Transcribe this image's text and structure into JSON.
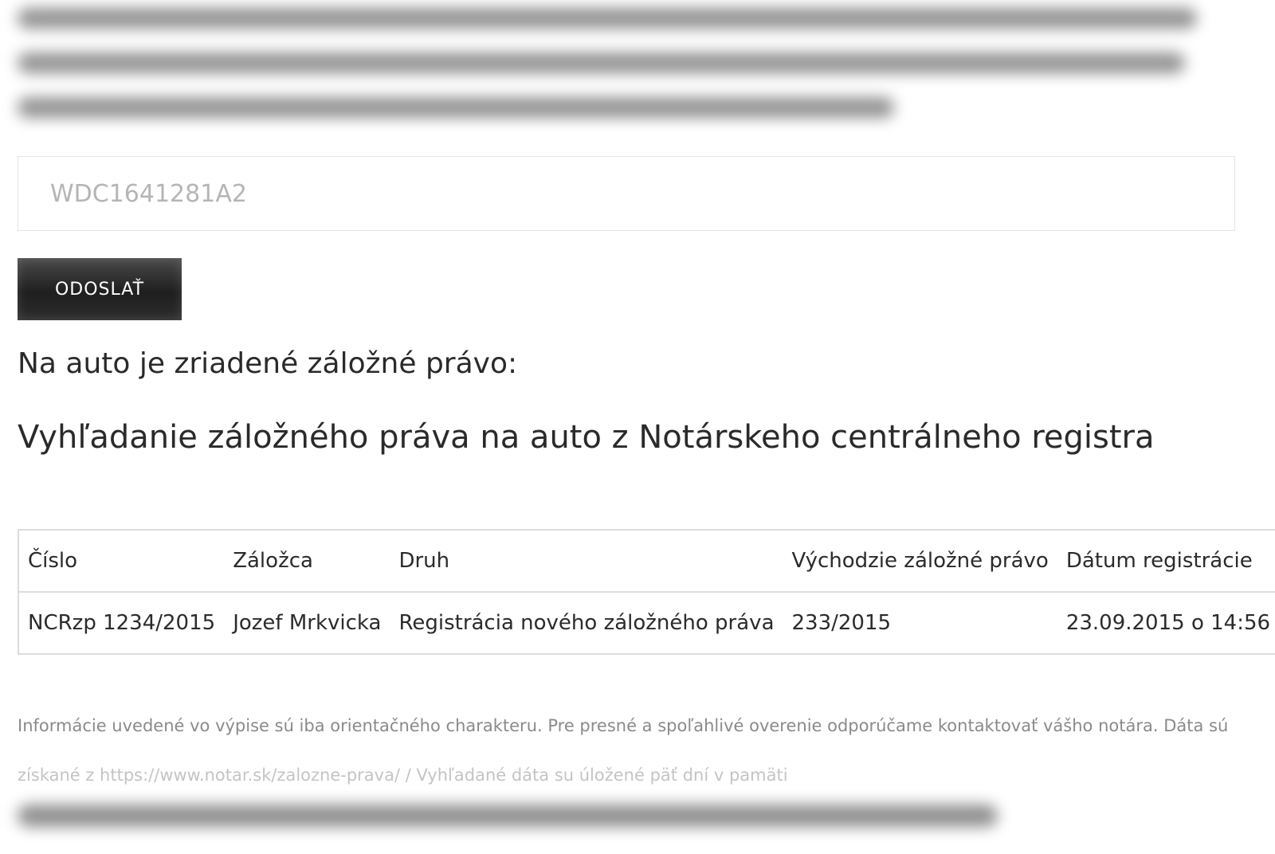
{
  "form": {
    "vin_placeholder": "WDC1641281A2",
    "submit_label": "ODOSLAŤ"
  },
  "result": {
    "status_heading": "Na auto je zriadené záložné právo:",
    "section_title": "Vyhľadanie záložného práva na auto z Notárskeho centrálneho registra"
  },
  "table": {
    "headers": [
      "Číslo",
      "Záložca",
      "Druh",
      "Východzie záložné právo",
      "Dátum registrácie"
    ],
    "rows": [
      [
        "NCRzp 1234/2015",
        "Jozef Mrkvicka",
        "Registrácia nového záložného práva",
        "233/2015",
        "23.09.2015 o 14:56"
      ]
    ]
  },
  "disclaimer": {
    "line1": "Informácie uvedené vo výpise sú iba orientačného charakteru. Pre presné a spoľahlivé overenie odporúčame kontaktovať vášho notára. Dáta sú",
    "line2": "získané z https://www.notar.sk/zalozne-prava/ / Vyhľadané dáta su úložené päť dní v pamäti"
  }
}
